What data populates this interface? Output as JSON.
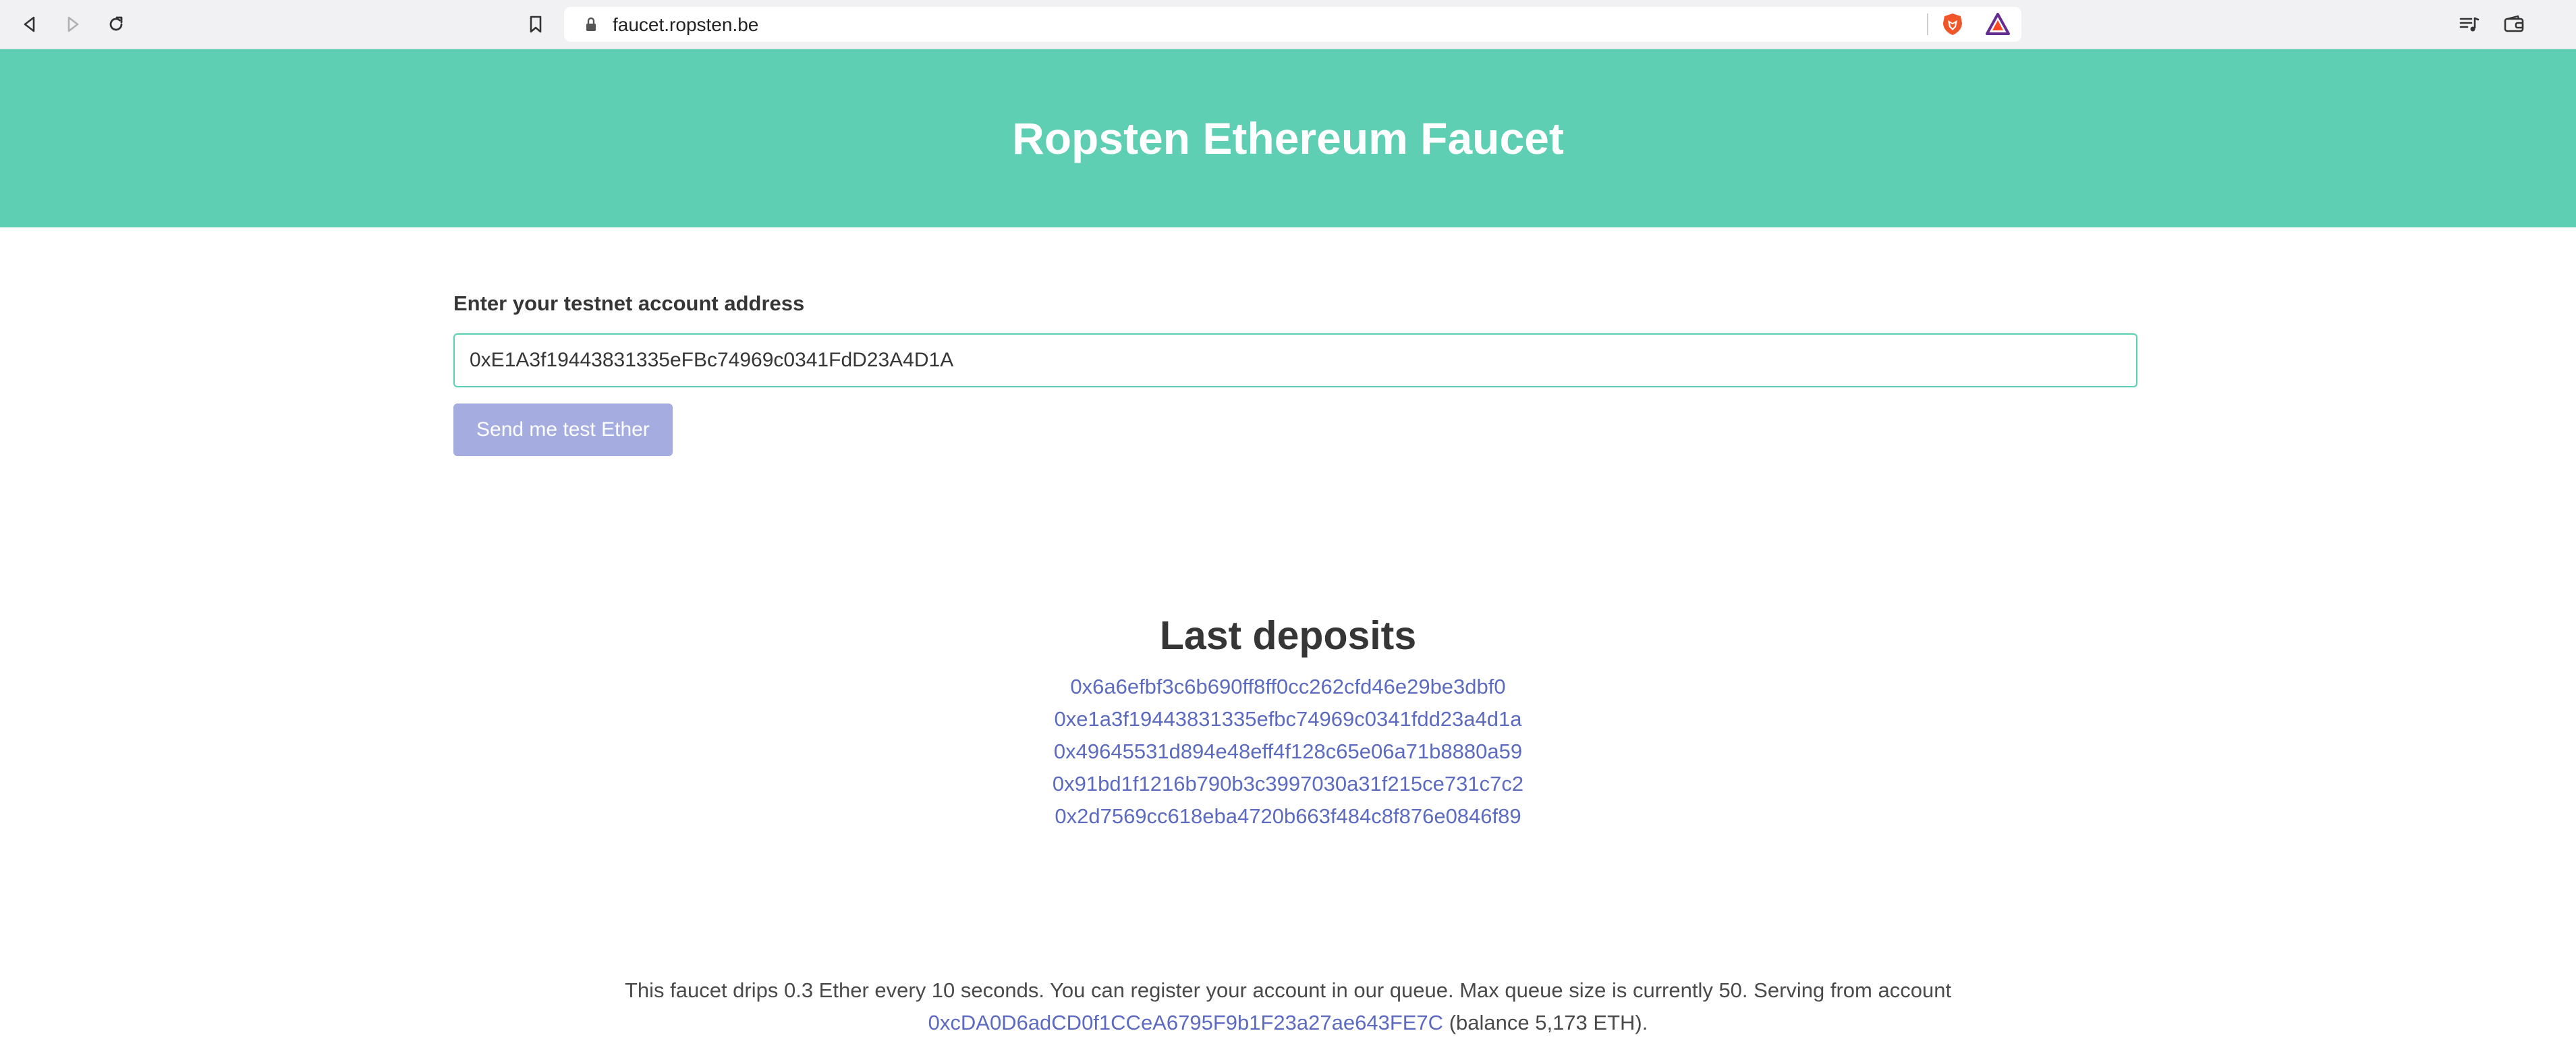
{
  "browser": {
    "url": "faucet.ropsten.be"
  },
  "header": {
    "title": "Ropsten Ethereum Faucet"
  },
  "form": {
    "label": "Enter your testnet account address",
    "address_value": "0xE1A3f19443831335eFBc74969c0341FdD23A4D1A",
    "submit_label": "Send me test Ether"
  },
  "deposits": {
    "title": "Last deposits",
    "items": [
      "0x6a6efbf3c6b690ff8ff0cc262cfd46e29be3dbf0",
      "0xe1a3f19443831335efbc74969c0341fdd23a4d1a",
      "0x49645531d894e48eff4f128c65e06a71b8880a59",
      "0x91bd1f1216b790b3c3997030a31f215ce731c7c2",
      "0x2d7569cc618eba4720b663f484c8f876e0846f89"
    ]
  },
  "footer": {
    "text": "This faucet drips 0.3 Ether every 10 seconds. You can register your account in our queue. Max queue size is currently 50. Serving from account",
    "account": "0xcDA0D6adCD0f1CCeA6795F9b1F23a27ae643FE7C",
    "balance": "(balance 5,173 ETH)."
  },
  "colors": {
    "accent": "#5fcfb4",
    "button": "#a5acdf",
    "link": "#5c6bc0"
  },
  "icons": {
    "back": "back-arrow-icon",
    "forward": "forward-arrow-icon",
    "reload": "reload-icon",
    "bookmark": "bookmark-icon",
    "lock": "lock-icon",
    "brave": "brave-shields-icon",
    "rewards": "brave-rewards-icon",
    "playlist": "playlist-icon",
    "wallet": "wallet-icon"
  }
}
